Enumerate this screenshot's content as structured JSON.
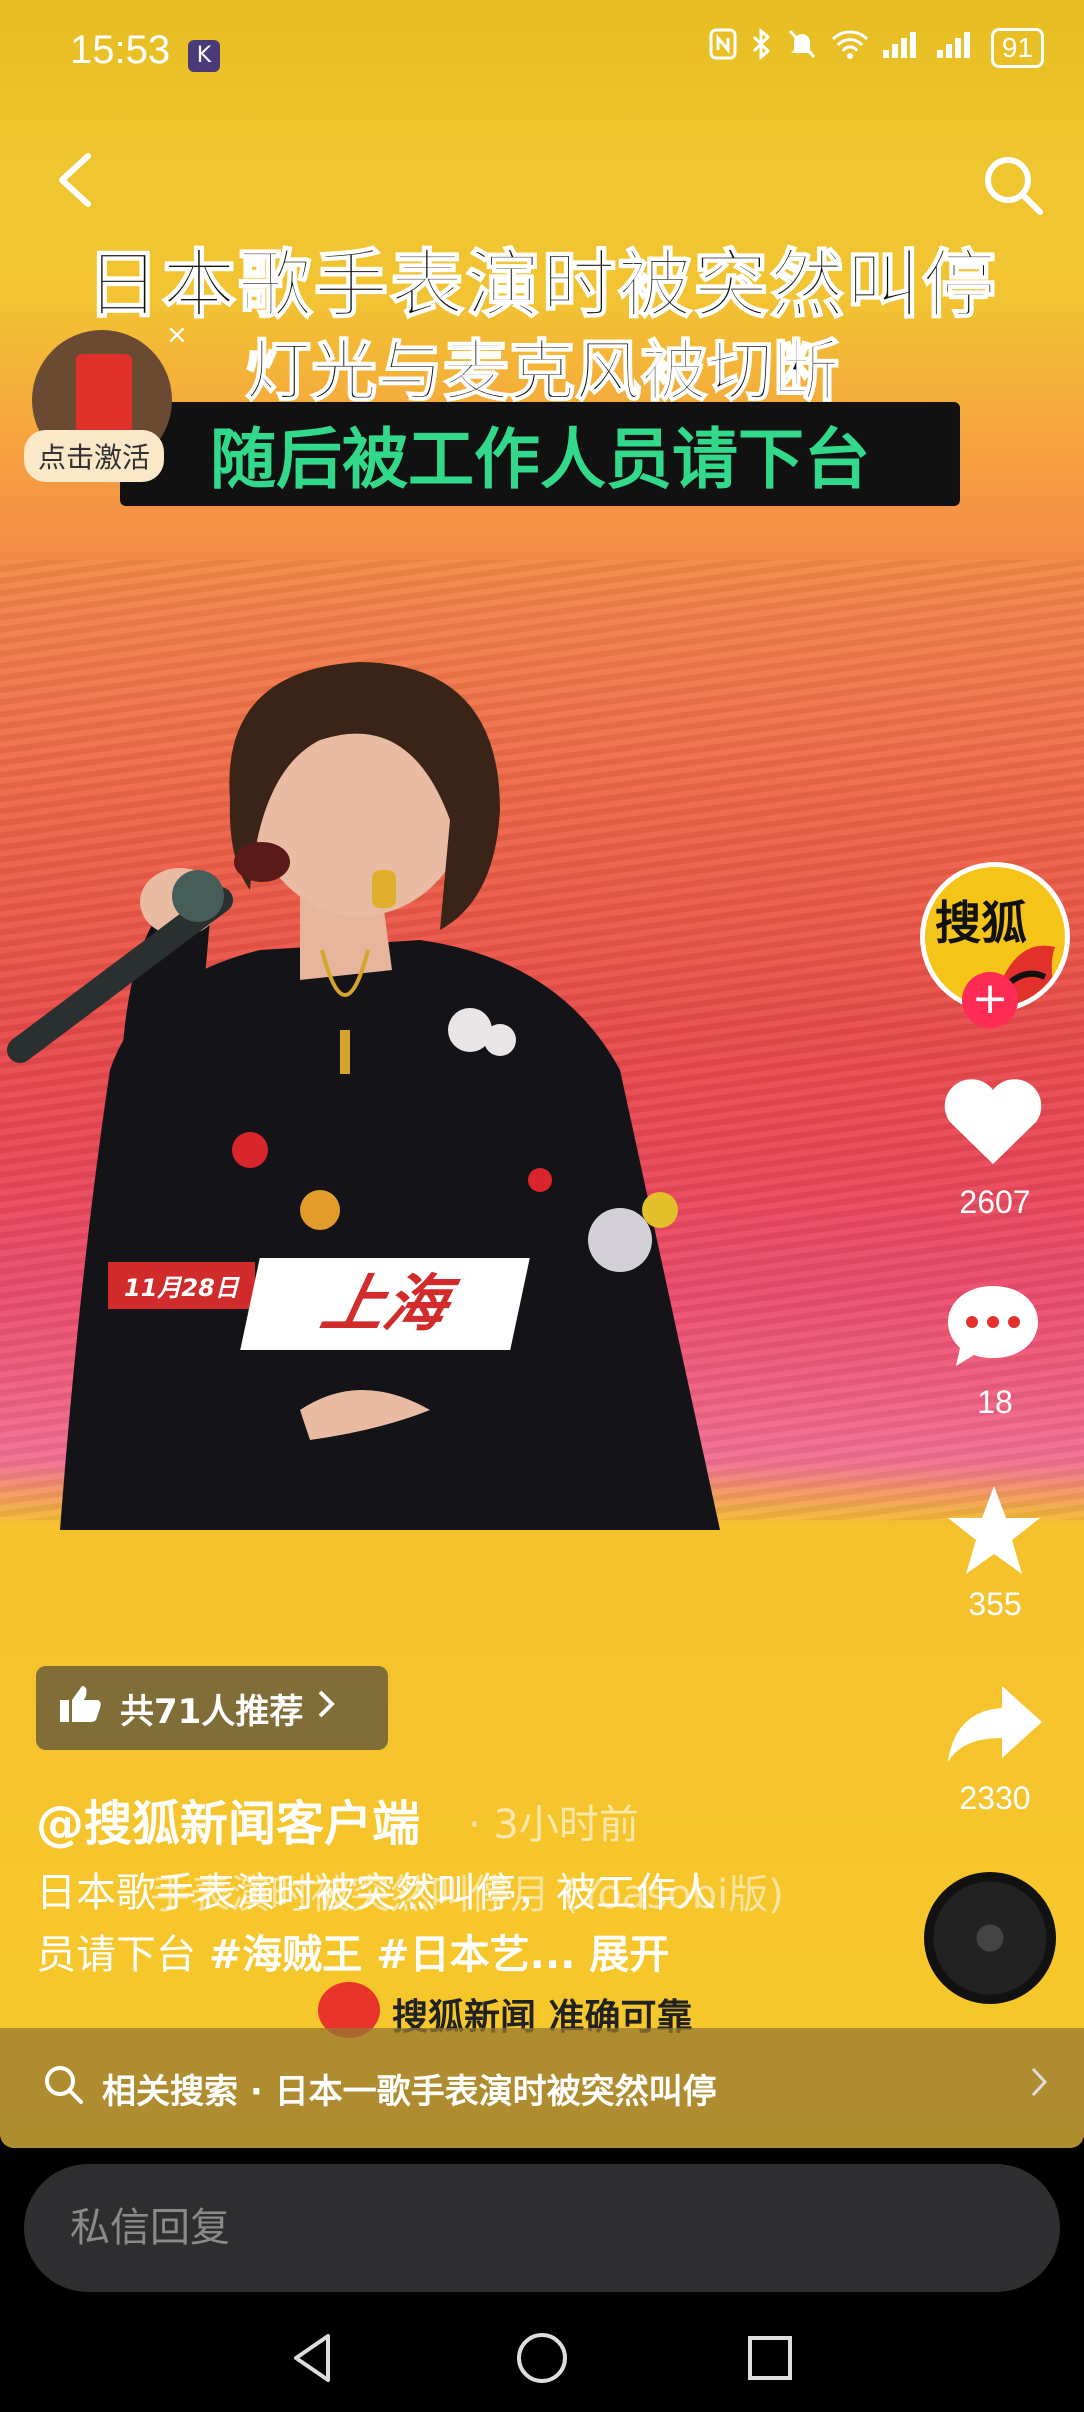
{
  "status_bar": {
    "time": "15:53",
    "app_badge": "K",
    "battery": "91"
  },
  "video": {
    "headline_1": "日本歌手表演时被突然叫停",
    "headline_2": "灯光与麦克风被切断",
    "headline_3": "随后被工作人员请下台",
    "date_tag": "11月28日",
    "city_tag": "上海"
  },
  "activate_widget": {
    "label": "点击激活",
    "close": "×"
  },
  "rail": {
    "avatar_text": "搜狐",
    "follow": "+",
    "like_count": "2607",
    "comment_count": "18",
    "favorite_count": "355",
    "share_count": "2330"
  },
  "recommend": {
    "label": "共71人推荐"
  },
  "post": {
    "author": "@搜狐新闻客户端",
    "time_ago": "· 3小时前",
    "desc_line1": "日本歌手表演时被突然叫停，被工作人",
    "desc_line2_prefix": "员请下台 ",
    "tag1": "#海贼王",
    "tag2": " #日本艺...",
    "more": " 展开",
    "music_overlay": "手表演时被突然叫停月 (Yoasobi版)"
  },
  "watermark": {
    "text": "搜狐新闻 准确可靠"
  },
  "related_search": {
    "label": "相关搜索 · 日本一歌手表演时被突然叫停"
  },
  "reply": {
    "placeholder": "私信回复"
  },
  "colors": {
    "follow_red": "#fe2c55",
    "headline_green": "#33d98a",
    "brand_yellow": "#f4c419"
  }
}
